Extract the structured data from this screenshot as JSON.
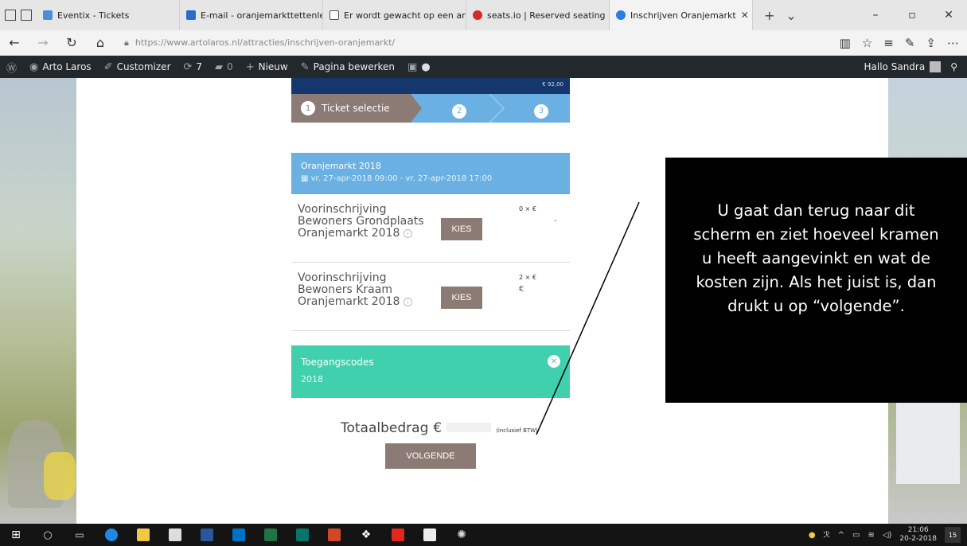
{
  "browser": {
    "tabs": [
      {
        "label": "Eventix - Tickets",
        "color": "#4a90d9"
      },
      {
        "label": "E-mail - oranjemarkttettenle",
        "color": "#2b6cc4"
      },
      {
        "label": "Er wordt gewacht op een ar",
        "color": "#555555"
      },
      {
        "label": "seats.io | Reserved seating p",
        "color": "#d22b2b"
      },
      {
        "label": "Inschrijven Oranjemarkt",
        "color": "#2a7de1"
      }
    ],
    "url_host": "https://www.artolaros.nl",
    "url_path": "/attracties/inschrijven-oranjemarkt/"
  },
  "wpbar": {
    "site": "Arto Laros",
    "customizer": "Customizer",
    "updates": "7",
    "comments": "0",
    "new": "Nieuw",
    "edit": "Pagina bewerken",
    "greeting": "Hallo Sandra"
  },
  "widget": {
    "top_price": "€ 92,00",
    "step1_num": "1",
    "step1_label": "Ticket selectie",
    "step2_num": "2",
    "step3_num": "3",
    "event_title": "Oranjemarkt 2018",
    "event_date": "vr. 27-apr-2018 09:00 - vr. 27-apr-2018 17:00",
    "tickets": [
      {
        "name": "Voorinschrijving Bewoners Grondplaats Oranjemarkt 2018",
        "button": "KIES",
        "qty": "0 × €",
        "price": "-"
      },
      {
        "name": "Voorinschrijving Bewoners Kraam Oranjemarkt 2018",
        "button": "KIES",
        "qty": "2 × €",
        "price": "€"
      }
    ],
    "codes_title": "Toegangscodes",
    "codes_year": "2018",
    "total_label": "Totaalbedrag",
    "total_euro": "€",
    "total_btw": "(inclusief BTW)",
    "next_button": "VOLGENDE"
  },
  "callout": {
    "lines": [
      "U gaat dan terug naar dit",
      "scherm en ziet hoeveel kramen",
      "u heeft aangevinkt en wat de",
      "kosten zijn.  Als het juist is, dan",
      "drukt u op “volgende”."
    ]
  },
  "taskbar": {
    "time": "21:06",
    "date": "20-2-2018",
    "notifications": "15"
  }
}
